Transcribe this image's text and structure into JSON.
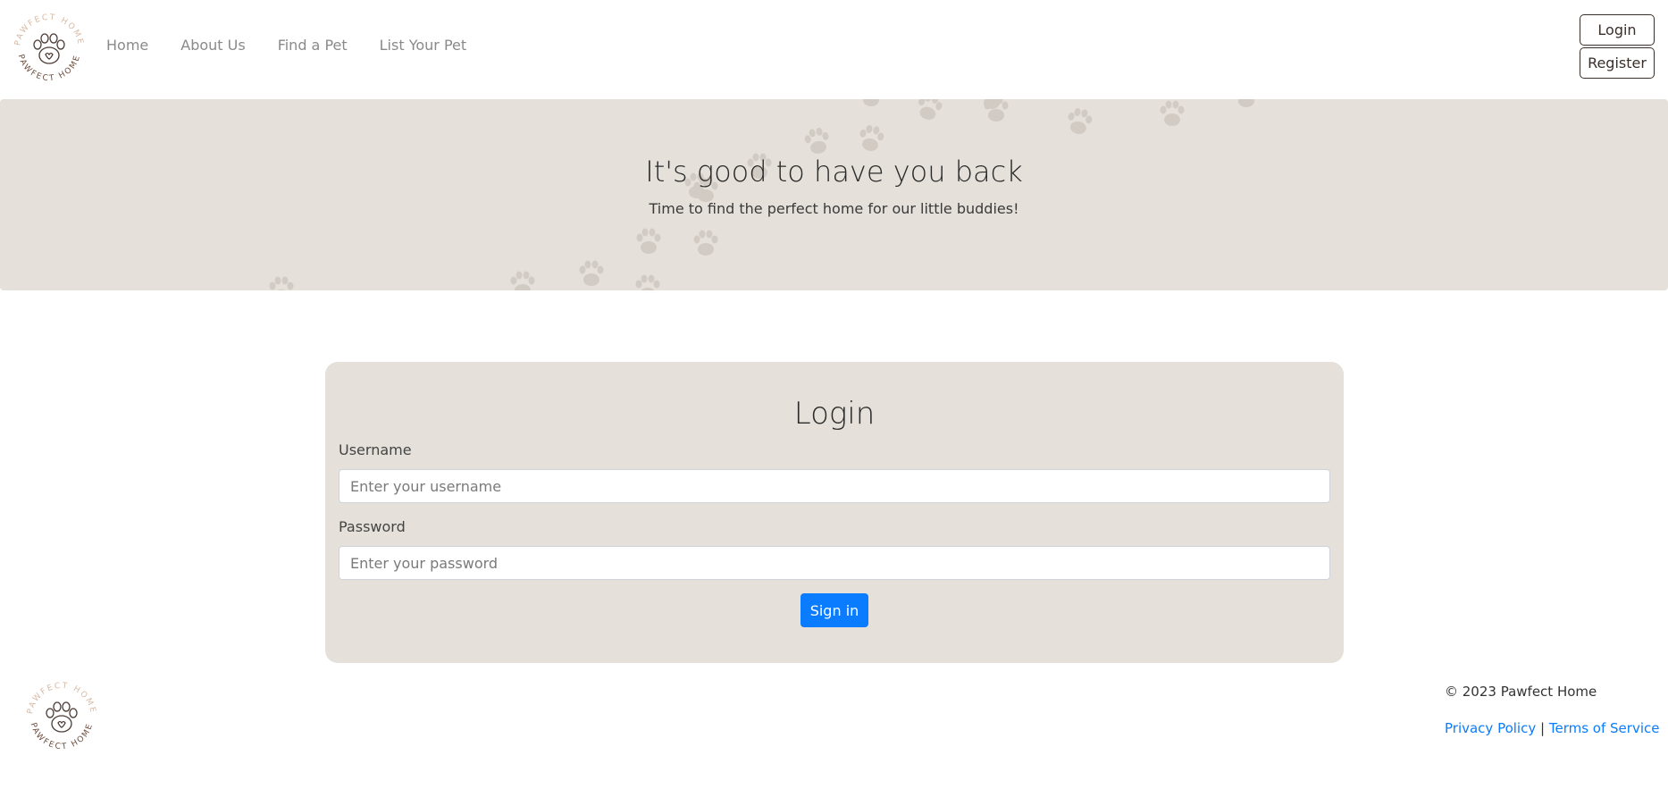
{
  "brand": {
    "logo_text": "PAWFECT HOME",
    "logo_icon": "paw-heart-icon"
  },
  "nav": {
    "items": [
      {
        "label": "Home"
      },
      {
        "label": "About Us"
      },
      {
        "label": "Find a Pet"
      },
      {
        "label": "List Your Pet"
      }
    ]
  },
  "auth": {
    "login_label": "Login",
    "register_label": "Register"
  },
  "hero": {
    "title": "It's good to have you back",
    "subtitle": "Time to find the perfect home for our little buddies!"
  },
  "login_form": {
    "title": "Login",
    "username_label": "Username",
    "username_placeholder": "Enter your username",
    "username_value": "",
    "password_label": "Password",
    "password_placeholder": "Enter your password",
    "password_value": "",
    "submit_label": "Sign in"
  },
  "footer": {
    "copyright": "© 2023 Pawfect Home",
    "privacy_label": "Privacy Policy",
    "separator": "|",
    "terms_label": "Terms of Service"
  },
  "colors": {
    "accent": "#0a7cff",
    "hero_bg": "#e5e0da",
    "card_bg": "#e5e0da",
    "logo_brown": "#6b4c3b",
    "logo_tan": "#d8b9a3"
  }
}
